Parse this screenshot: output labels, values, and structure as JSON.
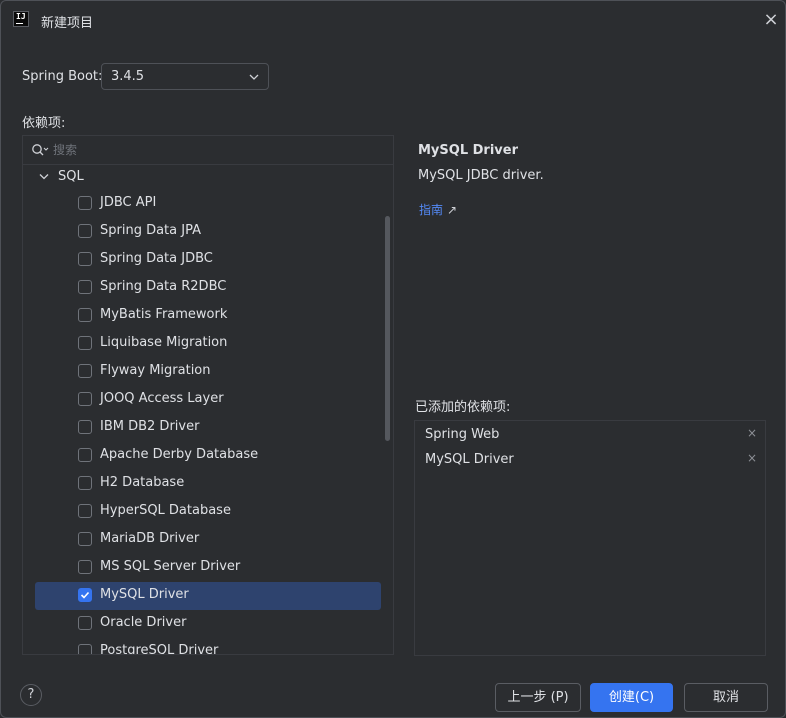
{
  "window": {
    "title": "新建项目",
    "close_icon": "close-icon"
  },
  "spring_boot": {
    "label": "Spring Boot:",
    "value": "3.4.5"
  },
  "dependencies": {
    "label": "依赖项:",
    "search_placeholder": "搜索",
    "group": "SQL",
    "items": [
      {
        "label": "JDBC API",
        "checked": false
      },
      {
        "label": "Spring Data JPA",
        "checked": false
      },
      {
        "label": "Spring Data JDBC",
        "checked": false
      },
      {
        "label": "Spring Data R2DBC",
        "checked": false
      },
      {
        "label": "MyBatis Framework",
        "checked": false
      },
      {
        "label": "Liquibase Migration",
        "checked": false
      },
      {
        "label": "Flyway Migration",
        "checked": false
      },
      {
        "label": "JOOQ Access Layer",
        "checked": false
      },
      {
        "label": "IBM DB2 Driver",
        "checked": false
      },
      {
        "label": "Apache Derby Database",
        "checked": false
      },
      {
        "label": "H2 Database",
        "checked": false
      },
      {
        "label": "HyperSQL Database",
        "checked": false
      },
      {
        "label": "MariaDB Driver",
        "checked": false
      },
      {
        "label": "MS SQL Server Driver",
        "checked": false
      },
      {
        "label": "MySQL Driver",
        "checked": true
      },
      {
        "label": "Oracle Driver",
        "checked": false
      },
      {
        "label": "PostgreSQL Driver",
        "checked": false
      }
    ]
  },
  "details": {
    "title": "MySQL Driver",
    "description": "MySQL JDBC driver.",
    "guide_link": "指南",
    "guide_arrow": "↗"
  },
  "added": {
    "label": "已添加的依赖项:",
    "items": [
      {
        "label": "Spring Web",
        "remove": "×"
      },
      {
        "label": "MySQL Driver",
        "remove": "×"
      }
    ]
  },
  "footer": {
    "help": "?",
    "prev_label": "上一步 (P)",
    "create_label": "创建(C)",
    "cancel_label": "取消"
  },
  "colors": {
    "accent": "#3574f0",
    "selection": "#2e436e",
    "highlight": "#e23a4c",
    "link": "#548af7"
  }
}
